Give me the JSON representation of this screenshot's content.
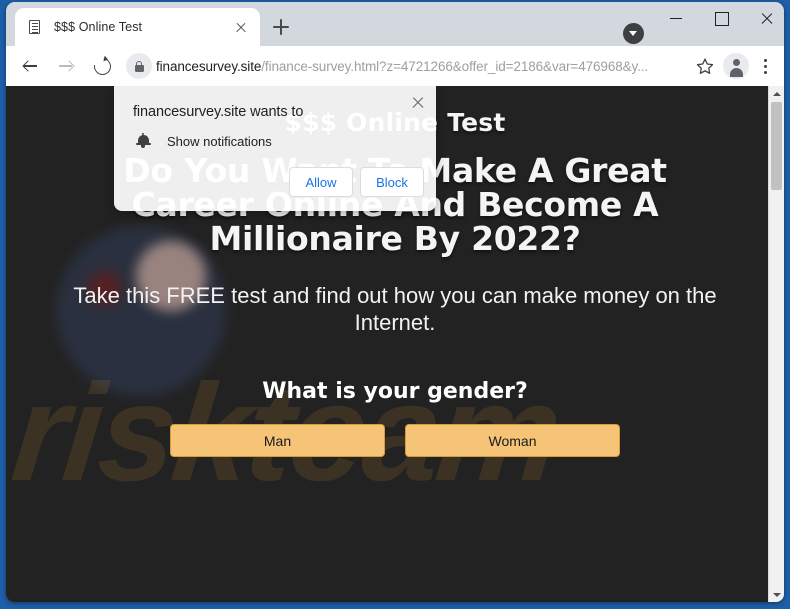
{
  "browser": {
    "tab": {
      "title": "$$$ Online Test",
      "favicon": "document-icon",
      "close_label": "×"
    },
    "new_tab_label": "+",
    "window_controls": {
      "minimize": "–",
      "maximize": "□",
      "close": "✕"
    },
    "toolbar": {
      "back": "←",
      "forward": "→",
      "reload": "⟳",
      "lock_icon": "lock-icon",
      "url_domain": "financesurvey.site",
      "url_path": "/finance-survey.html?z=4721266&offer_id=2186&var=476968&y...",
      "url_full": "financesurvey.site/finance-survey.html?z=4721266&offer_id=2186&var=476968&y...",
      "bookmark": "star-icon",
      "profile": "avatar-icon",
      "menu": "three-dots-icon"
    }
  },
  "notification_dialog": {
    "title": "financesurvey.site wants to",
    "permission_icon": "bell-icon",
    "permission_label": "Show notifications",
    "allow_label": "Allow",
    "block_label": "Block",
    "close_label": "×"
  },
  "page": {
    "kicker": "$$$ Online Test",
    "headline": "Do You Want To Make A Great Career Online And Become A Millionaire By 2022?",
    "subtext": "Take this FREE test and find out how you can make money on the Internet.",
    "question": "What is your gender?",
    "options": [
      {
        "label": "Man"
      },
      {
        "label": "Woman"
      }
    ],
    "watermark": "riskteam",
    "colors": {
      "background": "#222222",
      "button_fill": "#f5c477",
      "button_border": "#d99b33",
      "watermark": "#b98030",
      "link_blue": "#1a73e8"
    }
  }
}
